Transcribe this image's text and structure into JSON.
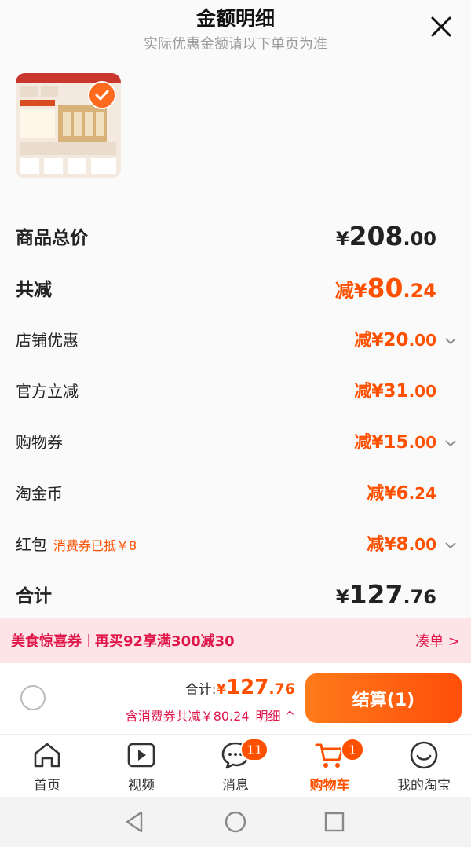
{
  "header": {
    "title": "金额明细",
    "subtitle": "实际优惠金额请以下单页为准"
  },
  "rows": [
    {
      "label": "商品总价",
      "prefix": "¥",
      "int": "208",
      "dec": ".00"
    },
    {
      "label": "共减",
      "prefix": "减¥",
      "int": "80",
      "dec": ".24"
    },
    {
      "label": "店铺优惠",
      "prefix": "减¥",
      "int": "20",
      "dec": ".00"
    },
    {
      "label": "官方立减",
      "prefix": "减¥",
      "int": "31",
      "dec": ".00"
    },
    {
      "label": "购物券",
      "prefix": "减¥",
      "int": "15",
      "dec": ".00"
    },
    {
      "label": "淘金币",
      "prefix": "减¥",
      "int": "6",
      "dec": ".24"
    },
    {
      "label": "红包",
      "note": "消费券已抵￥8",
      "prefix": "减¥",
      "int": "8",
      "dec": ".00"
    },
    {
      "label": "合计",
      "prefix": "¥",
      "int": "127",
      "dec": ".76"
    }
  ],
  "promo": {
    "tag": "美食惊喜券",
    "desc": "再买92享满300减30",
    "action": "凑单 >"
  },
  "checkout": {
    "total_label": "合计:",
    "total_prefix": "¥",
    "total_int": "127",
    "total_dec": ".76",
    "saving": "含消费券共减￥80.24",
    "detail": "明细 ^",
    "pay": "结算(1)"
  },
  "tabs": [
    {
      "label": "首页",
      "icon": "home-icon"
    },
    {
      "label": "视频",
      "icon": "video-icon"
    },
    {
      "label": "消息",
      "icon": "message-icon",
      "badge": "11"
    },
    {
      "label": "购物车",
      "icon": "cart-icon",
      "badge": "1",
      "active": true
    },
    {
      "label": "我的淘宝",
      "icon": "profile-icon"
    }
  ],
  "colors": {
    "accent": "#ff5000",
    "promo": "#e0174a"
  }
}
